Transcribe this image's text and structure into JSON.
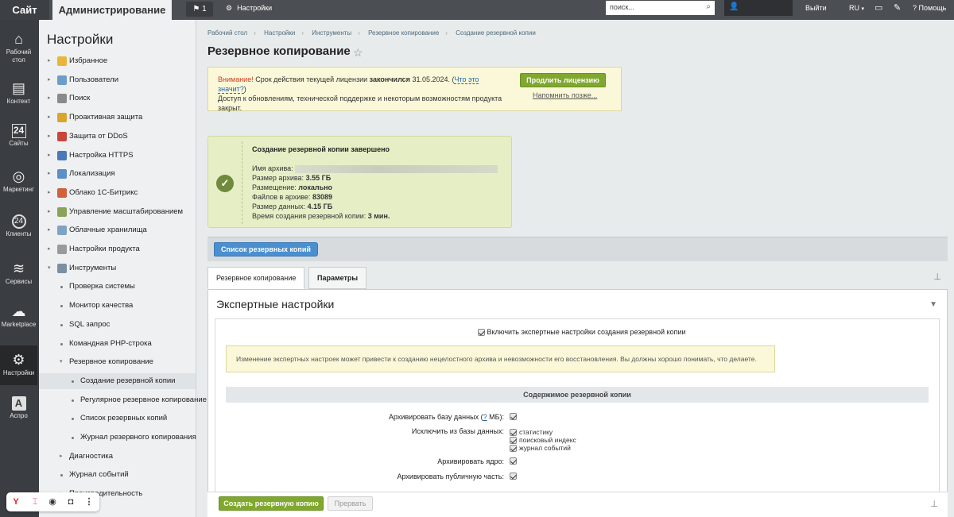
{
  "topbar": {
    "site": "Сайт",
    "admin": "Администрирование",
    "notifications_count": "1",
    "settings": "Настройки",
    "search_placeholder": "поиск...",
    "exit": "Выйти",
    "lang": "RU",
    "help": "Помощь"
  },
  "iconbar": {
    "items": [
      {
        "label": "Рабочий стол",
        "icon": "home-icon"
      },
      {
        "label": "Контент",
        "icon": "document-icon"
      },
      {
        "label": "Сайты",
        "icon": "calendar-icon"
      },
      {
        "label": "Маркетинг",
        "icon": "target-icon"
      },
      {
        "label": "Клиенты",
        "icon": "clients-icon"
      },
      {
        "label": "Сервисы",
        "icon": "layers-icon"
      },
      {
        "label": "Marketplace",
        "icon": "cloud-download-icon"
      },
      {
        "label": "Настройки",
        "icon": "gear-icon"
      },
      {
        "label": "Аспро",
        "icon": "aspro-icon"
      }
    ]
  },
  "nav": {
    "title": "Настройки",
    "items": [
      {
        "label": "Избранное"
      },
      {
        "label": "Пользователи"
      },
      {
        "label": "Поиск"
      },
      {
        "label": "Проактивная защита"
      },
      {
        "label": "Защита от DDoS"
      },
      {
        "label": "Настройка HTTPS"
      },
      {
        "label": "Локализация"
      },
      {
        "label": "Облако 1С-Битрикс"
      },
      {
        "label": "Управление масштабированием"
      },
      {
        "label": "Облачные хранилища"
      },
      {
        "label": "Настройки продукта"
      },
      {
        "label": "Инструменты"
      },
      {
        "label": "Проверка системы"
      },
      {
        "label": "Монитор качества"
      },
      {
        "label": "SQL запрос"
      },
      {
        "label": "Командная PHP-строка"
      },
      {
        "label": "Резервное копирование"
      },
      {
        "label": "Создание резервной копии"
      },
      {
        "label": "Регулярное резервное копирование"
      },
      {
        "label": "Список резервных копий"
      },
      {
        "label": "Журнал резервного копирования"
      },
      {
        "label": "Диагностика"
      },
      {
        "label": "Журнал событий"
      },
      {
        "label": "Производительность"
      }
    ]
  },
  "breadcrumb": [
    "Рабочий стол",
    "Настройки",
    "Инструменты",
    "Резервное копирование",
    "Создание резервной копии"
  ],
  "page_title": "Резервное копирование",
  "license": {
    "attention": "Внимание!",
    "text1": " Срок действия текущей лицензии ",
    "expired": "закончился",
    "date": " 31.05.2024. (",
    "what_link": "Что это значит?",
    "close_paren": ")",
    "text2": "Доступ к обновлениям, технической поддержке и некоторым возможностям продукта закрыт.",
    "renew_button": "Продлить лицензию",
    "remind_link": "Напомнить позже..."
  },
  "backup_result": {
    "title": "Создание резервной копии завершено",
    "archive_name_label": "Имя архива:",
    "archive_size_label": "Размер архива:",
    "archive_size": "3.55 ГБ",
    "location_label": "Размещение:",
    "location": "локально",
    "files_label": "Файлов в архиве:",
    "files": "83089",
    "data_size_label": "Размер данных:",
    "data_size": "4.15 ГБ",
    "time_label": "Время создания резервной копии:",
    "time": "3 мин."
  },
  "list_button": "Список резервных копий",
  "tabs": [
    "Резервное копирование",
    "Параметры"
  ],
  "expert": {
    "title": "Экспертные настройки",
    "enable_label": "Включить экспертные настройки создания резервной копии",
    "notice": "Изменение экспертных настроек может привести к созданию нецелостного архива и невозможности его восстановления. Вы должны хорошо понимать, что делаете.",
    "section_title": "Содержимое резервной копии",
    "archive_db_label": "Архивировать базу данных (",
    "archive_db_q": "?",
    "archive_db_unit": " МБ):",
    "exclude_label": "Исключить из базы данных:",
    "exclude_options": [
      "статистику",
      "поисковый индекс",
      "журнал событий"
    ],
    "archive_core_label": "Архивировать ядро:",
    "archive_public_label": "Архивировать публичную часть:"
  },
  "footer": {
    "create_button": "Создать резервную копию",
    "stop_button": "Прервать"
  },
  "floatbar": {
    "icons": [
      "yandex-icon",
      "translate-icon",
      "eye-icon",
      "camera-icon",
      "more-icon"
    ]
  }
}
